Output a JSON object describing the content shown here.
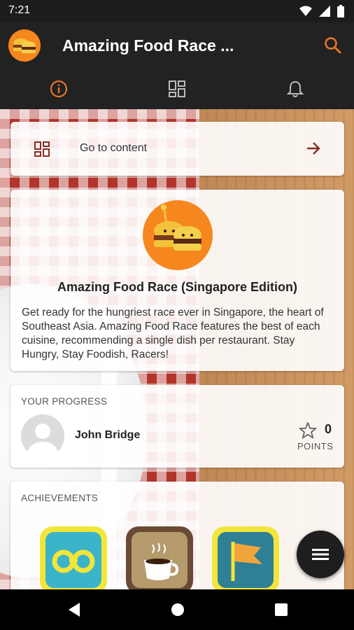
{
  "status_bar": {
    "time": "7:21",
    "icons": [
      "wifi-icon",
      "signal-icon",
      "battery-icon"
    ]
  },
  "app_bar": {
    "title": "Amazing Food Race ...",
    "logo_icon": "burger-logo-icon",
    "search_icon": "search-icon"
  },
  "tabs": [
    {
      "name": "info",
      "icon": "info-icon",
      "active": true
    },
    {
      "name": "content",
      "icon": "grid-icon",
      "active": false
    },
    {
      "name": "notifications",
      "icon": "bell-icon",
      "active": false
    }
  ],
  "goto_content": {
    "label": "Go to content",
    "icon": "grid-icon",
    "arrow_icon": "arrow-right-icon"
  },
  "game": {
    "title": "Amazing Food Race (Singapore Edition)",
    "description": "Get ready for the hungriest race ever in Singapore, the heart of Southeast Asia. Amazing Food Race features the best of each cuisine, recommending a single dish per restaurant. Stay Hungry, Stay Foodish, Racers!"
  },
  "progress": {
    "section_label": "YOUR PROGRESS",
    "user_name": "John Bridge",
    "points": "0",
    "points_label": "POINTS"
  },
  "achievements": {
    "section_label": "ACHIEVEMENTS",
    "badges": [
      "binoculars-badge-icon",
      "coffee-badge-icon",
      "flag-badge-icon"
    ]
  },
  "fab": {
    "icon": "menu-icon"
  },
  "colors": {
    "accent": "#e8742a",
    "app_bar": "#222222",
    "logo_bg": "#f6871f",
    "arrow": "#8a2c1e"
  }
}
